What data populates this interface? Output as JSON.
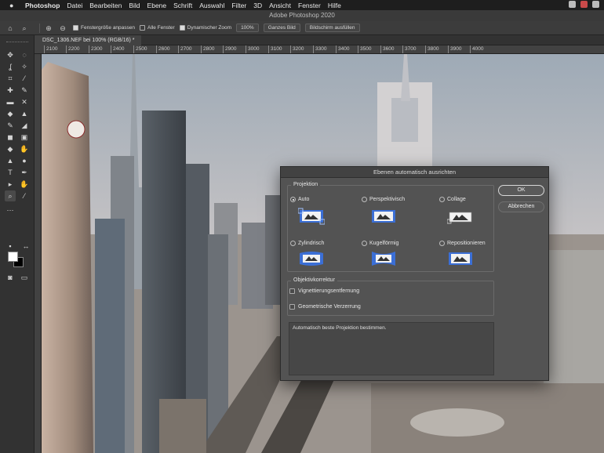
{
  "menubar": {
    "app_name": "Photoshop",
    "items": [
      "Datei",
      "Bearbeiten",
      "Bild",
      "Ebene",
      "Schrift",
      "Auswahl",
      "Filter",
      "3D",
      "Ansicht",
      "Fenster",
      "Hilfe"
    ]
  },
  "window": {
    "title": "Adobe Photoshop 2020"
  },
  "options_bar": {
    "chk_resize": "Fenstergröße anpassen",
    "chk_all_windows": "Alle Fenster",
    "chk_scrubby": "Dynamischer Zoom",
    "zoom_value": "100%",
    "btn_fit": "Ganzes Bild",
    "btn_fill": "Bildschirm ausfüllen"
  },
  "document": {
    "tab_label": "DSC_1306.NEF bei 100% (RGB/16) *"
  },
  "ruler": {
    "ticks": [
      "2100",
      "2200",
      "2300",
      "2400",
      "2500",
      "2600",
      "2700",
      "2800",
      "2900",
      "3000",
      "3100",
      "3200",
      "3300",
      "3400",
      "3500",
      "3600",
      "3700",
      "3800",
      "3900",
      "4000"
    ]
  },
  "dialog": {
    "title": "Ebenen automatisch ausrichten",
    "projection_group": "Projektion",
    "options": {
      "auto": "Auto",
      "perspective": "Perspektivisch",
      "collage": "Collage",
      "cylindrical": "Zylindrisch",
      "spherical": "Kugelförmig",
      "reposition": "Repositionieren"
    },
    "selected": "auto",
    "lens_group": "Objektivkorrektur",
    "vignette": "Vignettierungsentfernung",
    "distortion": "Geometrische Verzerrung",
    "description": "Automatisch beste Projektion bestimmen.",
    "ok": "OK",
    "cancel": "Abbrechen"
  },
  "colors": {
    "accent_blue": "#3b6fd6",
    "dialog_bg": "#535353"
  }
}
